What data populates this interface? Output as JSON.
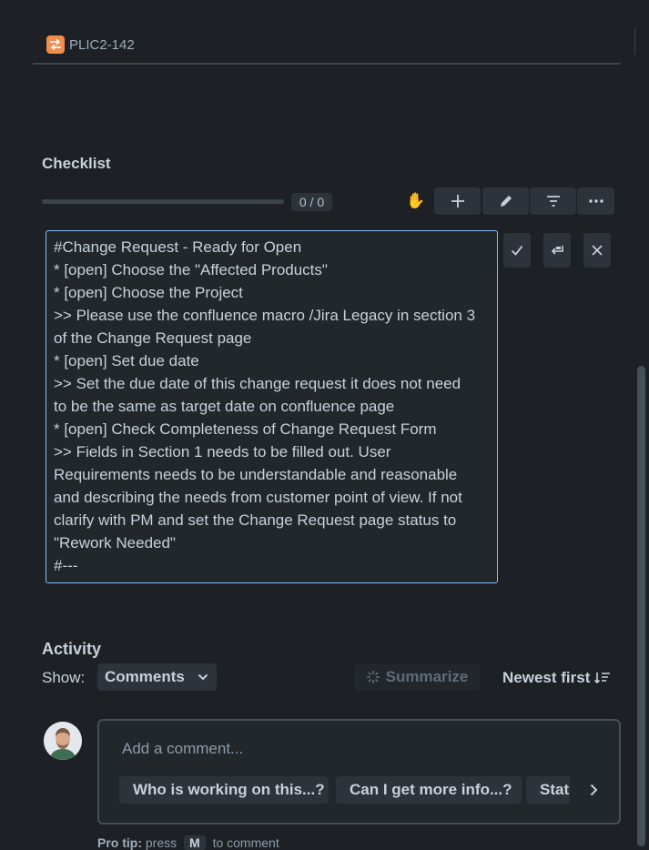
{
  "header": {
    "issue_key": "PLIC2-142",
    "issue_icon": "transition-icon"
  },
  "checklist": {
    "title": "Checklist",
    "progress_label": "0 / 0",
    "progress_fraction": 0,
    "toolbar": [
      "raise-hand-icon",
      "plus-icon",
      "pencil-icon",
      "filter-icon",
      "more-icon"
    ],
    "editor_lines": [
      "#Change Request - Ready for Open",
      "* [open] Choose the \"Affected Products\"",
      "* [open] Choose the Project",
      ">> Please use the confluence macro /Jira Legacy in section 3",
      "of the Change Request page",
      "* [open] Set due date",
      ">> Set the due date of this change request it does not need",
      "to be the same as target date on confluence page",
      "* [open] Check Completeness of Change Request Form",
      ">> Fields in Section 1 needs to be filled out. User",
      "Requirements needs to be understandable and reasonable",
      "and describing the needs from customer point of view. If not",
      "clarify with PM and set the Change Request page status to",
      "\"Rework Needed\"",
      "#---"
    ]
  },
  "activity": {
    "title": "Activity",
    "show_label": "Show:",
    "show_value": "Comments",
    "summarize_label": "Summarize",
    "sort_label": "Newest first",
    "comment_placeholder": "Add a comment...",
    "chips": [
      "Who is working on this...?",
      "Can I get more info...?",
      "Stat"
    ],
    "protip_prefix": "Pro tip:",
    "protip_press": "press",
    "protip_key": "M",
    "protip_suffix": "to comment"
  },
  "colors": {
    "background": "#1d2125",
    "accent": "#85b8ff",
    "issue_icon": "#f18d4e"
  }
}
